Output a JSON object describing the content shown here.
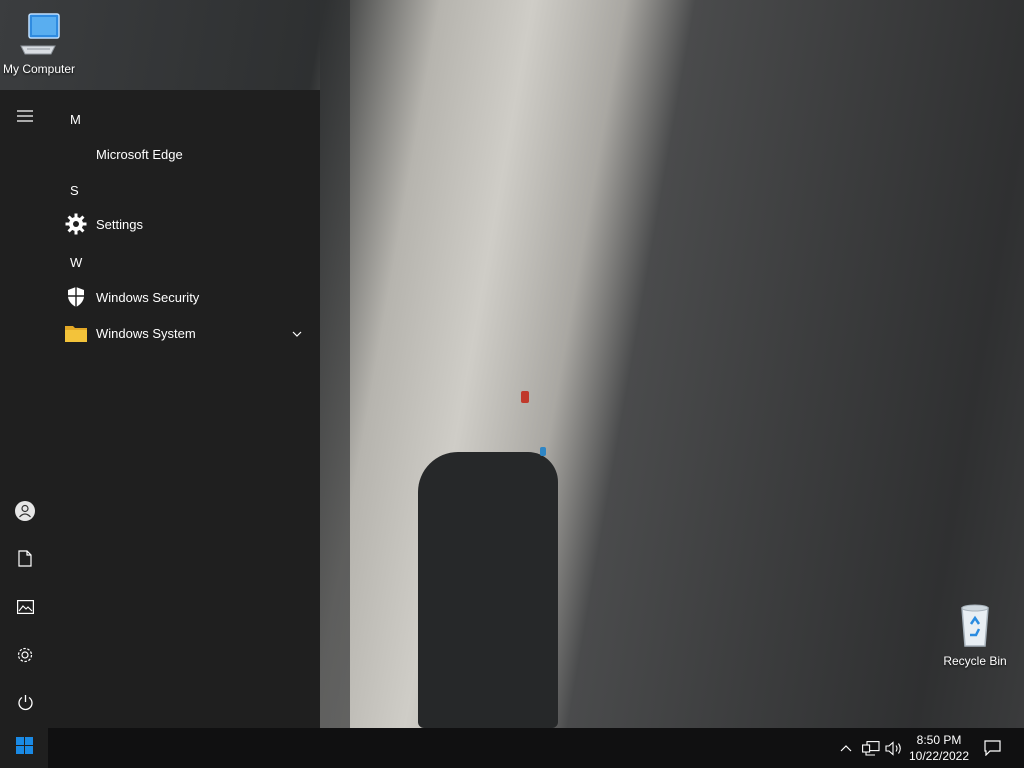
{
  "desktop": {
    "icons": [
      {
        "label": "My Computer",
        "icon": "computer-icon"
      },
      {
        "label": "Recycle Bin",
        "icon": "recycle-bin-icon"
      }
    ]
  },
  "start_menu": {
    "rail": {
      "menu": "hamburger-icon",
      "items": [
        "user-icon",
        "documents-icon",
        "pictures-icon",
        "settings-icon",
        "power-icon"
      ]
    },
    "groups": [
      {
        "letter": "M",
        "apps": [
          {
            "label": "Microsoft Edge",
            "icon": "edge-icon"
          }
        ]
      },
      {
        "letter": "S",
        "apps": [
          {
            "label": "Settings",
            "icon": "gear-icon"
          }
        ]
      },
      {
        "letter": "W",
        "apps": [
          {
            "label": "Windows Security",
            "icon": "shield-icon"
          },
          {
            "label": "Windows System",
            "icon": "folder-icon",
            "expandable": true
          }
        ]
      }
    ]
  },
  "taskbar": {
    "start": "windows-logo-icon",
    "tray": [
      "chevron-up-icon",
      "network-icon",
      "volume-icon"
    ],
    "time": "8:50 PM",
    "date": "10/22/2022",
    "notifications": "action-center-icon"
  },
  "colors": {
    "menu_bg": "#1f1f1f",
    "taskbar_bg": "#101011",
    "windows_blue": "#0078d7",
    "folder_yellow": "#f3c33a"
  }
}
